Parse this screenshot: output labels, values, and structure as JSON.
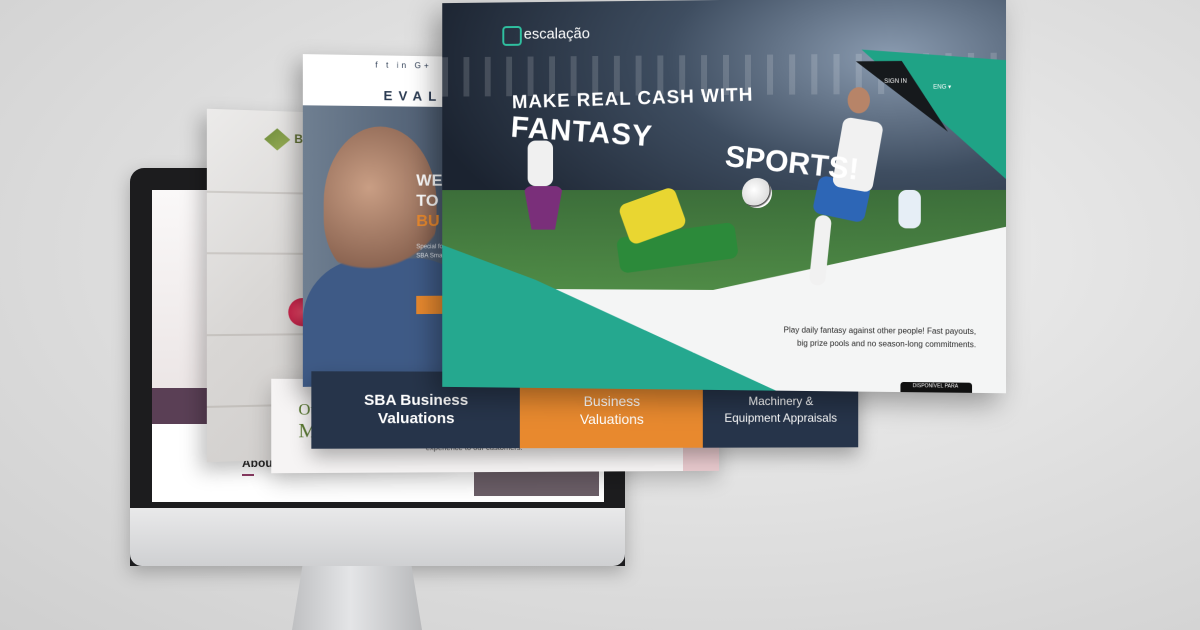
{
  "imac": {
    "about_title": "About Us"
  },
  "brick": {
    "logo_text": "Bric",
    "mission_our": "Ou",
    "mission_word": "Mission",
    "mission_text": "...tment of providing innovative and quality products with an outstanding experience to our customers."
  },
  "evalue": {
    "social": "f  t  in  G+",
    "logo": "EVALUE",
    "heading_1": "WE",
    "heading_2": "TO",
    "heading_3": "BU",
    "body_text": "Special for SBA Small B"
  },
  "tiles": [
    {
      "line1": "SBA Business",
      "line2": "Valuations"
    },
    {
      "line1": "Business",
      "line2": "Valuations"
    },
    {
      "line1": "Machinery &",
      "line2": "Equipment Appraisals"
    }
  ],
  "escalacao": {
    "logo": "escalação",
    "sign_in": "SIGN IN",
    "lang": "ENG ▾",
    "headline_1": "MAKE REAL CASH WITH",
    "headline_2": "FANTASY",
    "headline_3": "SPORTS!",
    "copy": "Play daily fantasy against other people! Fast payouts, big prize pools and no season-long commitments.",
    "badge": "DISPONÍVEL PARA",
    "accent_color": "#25a88f"
  }
}
